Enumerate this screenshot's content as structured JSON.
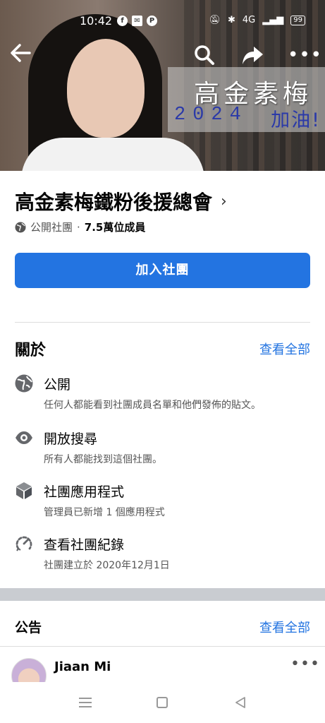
{
  "status_bar": {
    "time": "10:42",
    "network": "4G",
    "battery": "99"
  },
  "cover": {
    "banner_line1": "高金素梅",
    "banner_year": "2024",
    "banner_cheer": "加油!"
  },
  "toolbar": {
    "back_icon": "arrow-left-icon",
    "search_icon": "search-icon",
    "share_icon": "share-icon",
    "more_icon": "more-icon"
  },
  "group": {
    "name": "高金素梅鐵粉後援總會",
    "privacy": "公開社團",
    "separator": "·",
    "members": "7.5萬位成員",
    "join_label": "加入社團"
  },
  "about": {
    "heading": "關於",
    "see_all": "查看全部",
    "items": [
      {
        "icon": "globe-icon",
        "title": "公開",
        "subtitle": "任何人都能看到社團成員名單和他們發佈的貼文。"
      },
      {
        "icon": "eye-icon",
        "title": "開放搜尋",
        "subtitle": "所有人都能找到這個社團。"
      },
      {
        "icon": "cube-icon",
        "title": "社團應用程式",
        "subtitle": "管理員已新增 1 個應用程式"
      },
      {
        "icon": "history-icon",
        "title": "查看社團紀錄",
        "subtitle": "社團建立於 2020年12月1日"
      }
    ]
  },
  "announcements": {
    "heading": "公告",
    "see_all": "查看全部",
    "post": {
      "author": "Jiaan Mi",
      "more": "•••"
    }
  },
  "colors": {
    "accent": "#2374e1",
    "text_primary": "#050505",
    "text_secondary": "#555555"
  }
}
